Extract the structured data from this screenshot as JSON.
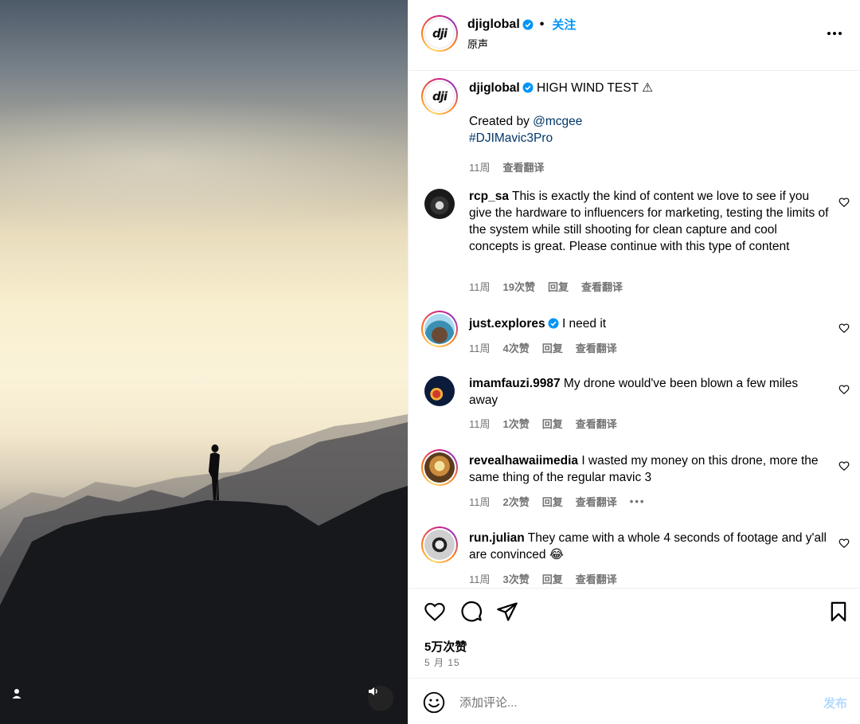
{
  "post": {
    "username": "djiglobal",
    "follow_label": "关注",
    "audio_label": "原声",
    "avatar_text": "dji"
  },
  "caption": {
    "username": "djiglobal",
    "title": "HIGH WIND TEST ⚠",
    "created_by_prefix": "Created by",
    "created_by_handle": "@mcgee",
    "hashtag": "#DJIMavic3Pro",
    "time": "11周",
    "translate": "查看翻译"
  },
  "comments": [
    {
      "username": "rcp_sa",
      "verified": false,
      "text": "This is exactly the kind of content we love to see if you give the hardware to influencers for marketing, testing the limits of the system while still shooting for clean capture and cool concepts is great. Please continue with this type of content",
      "time": "11周",
      "likes": "19次赞",
      "reply": "回复",
      "translate": "查看翻译"
    },
    {
      "username": "just.explores",
      "verified": true,
      "text": "I need it",
      "time": "11周",
      "likes": "4次赞",
      "reply": "回复",
      "translate": "查看翻译"
    },
    {
      "username": "imamfauzi.9987",
      "verified": false,
      "text": "My drone would've been blown a few miles away",
      "time": "11周",
      "likes": "1次赞",
      "reply": "回复",
      "translate": "查看翻译"
    },
    {
      "username": "revealhawaiimedia",
      "verified": false,
      "text": "I wasted my money on this drone, more the same thing of the regular mavic 3",
      "time": "11周",
      "likes": "2次赞",
      "reply": "回复",
      "translate": "查看翻译",
      "more": "•••"
    },
    {
      "username": "run.julian",
      "verified": false,
      "text": "They came with a whole 4 seconds of footage and y'all are convinced 😂",
      "time": "11周",
      "likes": "3次赞",
      "reply": "回复",
      "translate": "查看翻译"
    }
  ],
  "actions": {
    "likes_count": "5万次赞",
    "date": "5 月 15"
  },
  "add_comment": {
    "placeholder": "添加评论...",
    "post_label": "发布"
  },
  "colors": {
    "accent": "#0095f6",
    "link": "#00376b",
    "muted": "#737373",
    "post_disabled": "#b3dbff"
  },
  "icons": [
    "more-icon",
    "verified-badge-icon",
    "heart-icon",
    "comment-icon",
    "share-icon",
    "bookmark-icon",
    "emoji-icon",
    "sound-icon",
    "user-tag-icon"
  ]
}
